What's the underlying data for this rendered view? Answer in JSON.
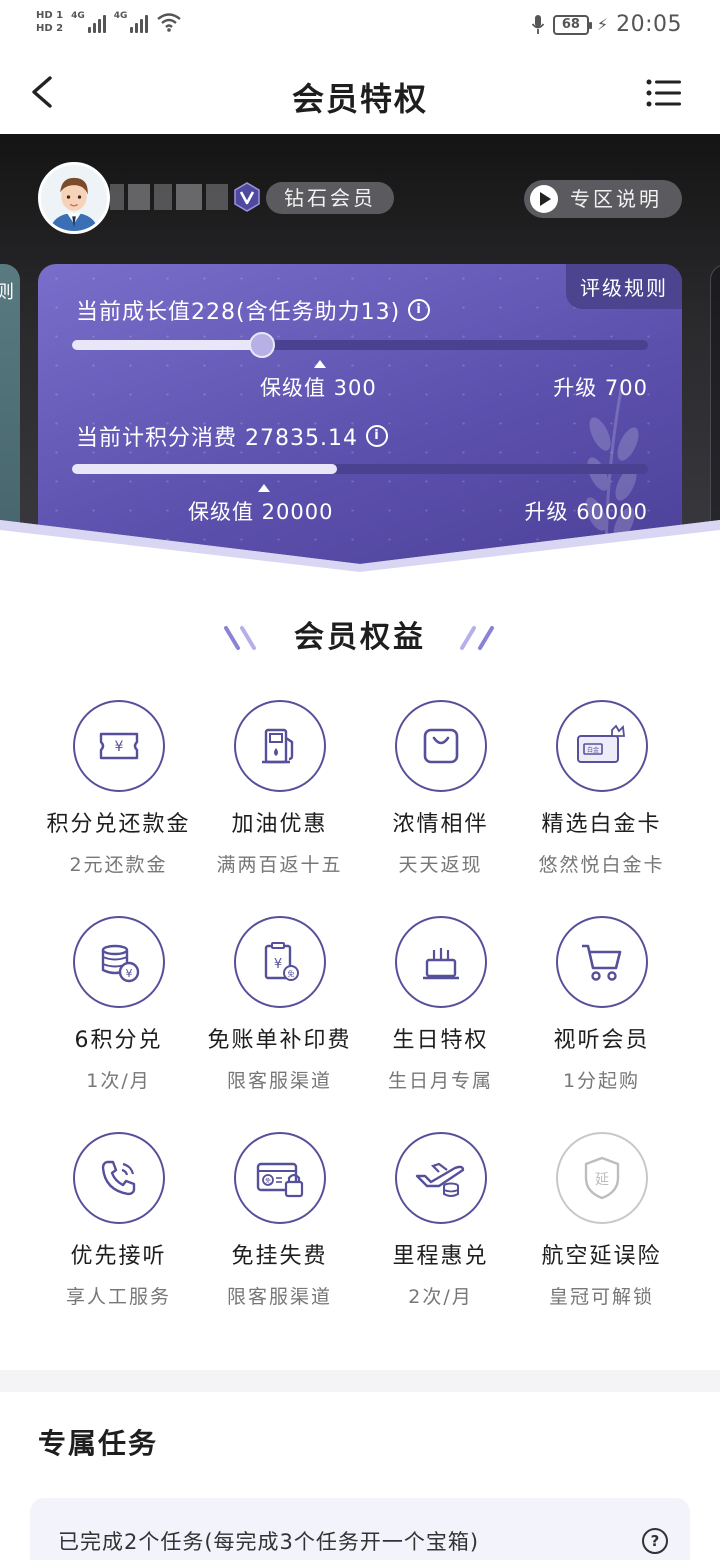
{
  "status_bar": {
    "hd1": "HD 1",
    "hd2": "HD 2",
    "net1": "4G",
    "net2": "4G",
    "battery": "68",
    "time": "20:05"
  },
  "header": {
    "title": "会员特权"
  },
  "hero": {
    "level": "钻石会员",
    "explain_button": "专区说明",
    "left_card_label": "则",
    "rule_tag": "评级规则",
    "growth_label": "当前成长值228(含任务助力13)",
    "growth_progress": 0.33,
    "growth_keep_label": "保级值 300",
    "growth_upgrade_label": "升级 700",
    "points_label": "当前计积分消费 27835.14",
    "points_progress": 0.46,
    "points_keep_label": "保级值 20000",
    "points_upgrade_label": "升级 60000"
  },
  "benefits": {
    "title": "会员权益",
    "items": [
      {
        "title": "积分兑还款金",
        "sub": "2元还款金",
        "icon": "voucher-icon"
      },
      {
        "title": "加油优惠",
        "sub": "满两百返十五",
        "icon": "fuel-icon"
      },
      {
        "title": "浓情相伴",
        "sub": "天天返现",
        "icon": "shopping-bag-icon"
      },
      {
        "title": "精选白金卡",
        "sub": "悠然悦白金卡",
        "icon": "platinum-card-icon"
      },
      {
        "title": "6积分兑",
        "sub": "1次/月",
        "icon": "coin-exchange-icon"
      },
      {
        "title": "免账单补印费",
        "sub": "限客服渠道",
        "icon": "bill-icon"
      },
      {
        "title": "生日特权",
        "sub": "生日月专属",
        "icon": "birthday-cake-icon"
      },
      {
        "title": "视听会员",
        "sub": "1分起购",
        "icon": "cart-icon"
      },
      {
        "title": "优先接听",
        "sub": "享人工服务",
        "icon": "phone-icon"
      },
      {
        "title": "免挂失费",
        "sub": "限客服渠道",
        "icon": "card-lock-icon"
      },
      {
        "title": "里程惠兑",
        "sub": "2次/月",
        "icon": "airplane-icon"
      },
      {
        "title": "航空延误险",
        "sub": "皇冠可解锁",
        "icon": "delay-shield-icon"
      }
    ]
  },
  "tasks": {
    "title": "专属任务",
    "summary": "已完成2个任务(每完成3个任务开一个宝箱)"
  },
  "colors": {
    "accent": "#56509a",
    "card_start": "#7a6ecb",
    "card_end": "#4a3f96"
  }
}
